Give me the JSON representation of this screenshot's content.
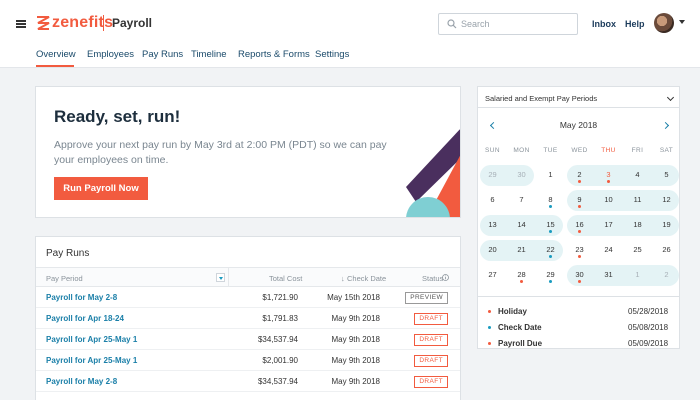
{
  "app": {
    "brand": "zenefits",
    "product": "Payroll",
    "brand_color": "#f25b3f"
  },
  "header": {
    "search_placeholder": "Search",
    "inbox_label": "Inbox",
    "help_label": "Help"
  },
  "tabs": [
    {
      "label": "Overview",
      "active": true
    },
    {
      "label": "Employees",
      "active": false
    },
    {
      "label": "Pay Runs",
      "active": false
    },
    {
      "label": "Timeline",
      "active": false
    },
    {
      "label": "Reports & Forms",
      "active": false
    },
    {
      "label": "Settings",
      "active": false
    }
  ],
  "hero": {
    "title": "Ready, set, run!",
    "message": "Approve your next pay run by May 3rd at 2:00 PM (PDT) so we can pay your employees on time.",
    "button_label": "Run Payroll Now"
  },
  "pay_runs": {
    "title": "Pay Runs",
    "columns": {
      "period": "Pay Period",
      "total": "Total Cost",
      "check_date": "Check Date",
      "status": "Status"
    },
    "rows": [
      {
        "period": "Payroll for May 2-8",
        "total": "$1,721.90",
        "check_date": "May 15th 2018",
        "status": "PREVIEW"
      },
      {
        "period": "Payroll for Apr 18-24",
        "total": "$1,791.83",
        "check_date": "May 9th 2018",
        "status": "DRAFT"
      },
      {
        "period": "Payroll for Apr 25-May 1",
        "total": "$34,537.94",
        "check_date": "May 9th 2018",
        "status": "DRAFT"
      },
      {
        "period": "Payroll for Apr 25-May 1",
        "total": "$2,001.90",
        "check_date": "May 9th 2018",
        "status": "DRAFT"
      },
      {
        "period": "Payroll for May 2-8",
        "total": "$34,537.94",
        "check_date": "May 9th 2018",
        "status": "DRAFT"
      }
    ]
  },
  "calendar": {
    "selector_label": "Salaried and Exempt Pay Periods",
    "month_label": "May 2018",
    "weekdays": [
      "SUN",
      "MON",
      "TUE",
      "WED",
      "THU",
      "FRI",
      "SAT"
    ],
    "today_weekday_index": 4,
    "weeks": [
      [
        "29",
        "30",
        "1",
        "2",
        "3",
        "4",
        "5"
      ],
      [
        "6",
        "7",
        "8",
        "9",
        "10",
        "11",
        "12"
      ],
      [
        "13",
        "14",
        "15",
        "16",
        "17",
        "18",
        "19"
      ],
      [
        "20",
        "21",
        "22",
        "23",
        "24",
        "25",
        "26"
      ],
      [
        "27",
        "28",
        "29",
        "30",
        "31",
        "1",
        "2"
      ]
    ],
    "legend": [
      {
        "label": "Holiday",
        "date": "05/28/2018",
        "color": "#f25b3f"
      },
      {
        "label": "Check Date",
        "date": "05/08/2018",
        "color": "#1a9bbf"
      },
      {
        "label": "Payroll Due",
        "date": "05/09/2018",
        "color": "#f25b3f"
      }
    ],
    "colors": {
      "band": "#e4f3f5",
      "check_dot": "#1a9bbf",
      "due_dot": "#f25b3f"
    }
  }
}
